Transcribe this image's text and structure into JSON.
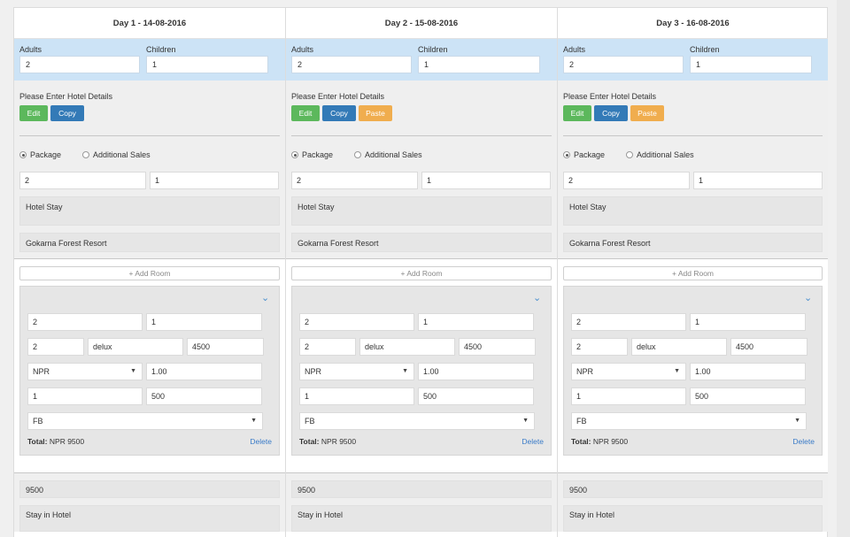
{
  "days": [
    {
      "title": "Day 1 -  14-08-2016",
      "adults_label": "Adults",
      "adults": "2",
      "children_label": "Children",
      "children": "1",
      "hotel_prompt": "Please Enter Hotel Details",
      "buttons": [
        "Edit",
        "Copy"
      ],
      "radio_package": "Package",
      "radio_additional": "Additional Sales",
      "count_a": "2",
      "count_b": "1",
      "service": "Hotel Stay",
      "hotel_name": "Gokarna Forest Resort",
      "add_room": "+ Add Room",
      "room": {
        "r1a": "2",
        "r1b": "1",
        "r2a": "2",
        "r2b": "delux",
        "r2c": "4500",
        "currency": "NPR",
        "rate": "1.00",
        "r4a": "1",
        "r4b": "500",
        "meal": "FB",
        "total_label": "Total:",
        "total_value": "NPR 9500",
        "delete": "Delete"
      },
      "amount": "9500",
      "note": "Stay in Hotel"
    },
    {
      "title": "Day 2 -  15-08-2016",
      "adults_label": "Adults",
      "adults": "2",
      "children_label": "Children",
      "children": "1",
      "hotel_prompt": "Please Enter Hotel Details",
      "buttons": [
        "Edit",
        "Copy",
        "Paste"
      ],
      "radio_package": "Package",
      "radio_additional": "Additional Sales",
      "count_a": "2",
      "count_b": "1",
      "service": "Hotel Stay",
      "hotel_name": "Gokarna Forest Resort",
      "add_room": "+ Add Room",
      "room": {
        "r1a": "2",
        "r1b": "1",
        "r2a": "2",
        "r2b": "delux",
        "r2c": "4500",
        "currency": "NPR",
        "rate": "1.00",
        "r4a": "1",
        "r4b": "500",
        "meal": "FB",
        "total_label": "Total:",
        "total_value": "NPR 9500",
        "delete": "Delete"
      },
      "amount": "9500",
      "note": "Stay in Hotel"
    },
    {
      "title": "Day 3 -  16-08-2016",
      "adults_label": "Adults",
      "adults": "2",
      "children_label": "Children",
      "children": "1",
      "hotel_prompt": "Please Enter Hotel Details",
      "buttons": [
        "Edit",
        "Copy",
        "Paste"
      ],
      "radio_package": "Package",
      "radio_additional": "Additional Sales",
      "count_a": "2",
      "count_b": "1",
      "service": "Hotel Stay",
      "hotel_name": "Gokarna Forest Resort",
      "add_room": "+ Add Room",
      "room": {
        "r1a": "2",
        "r1b": "1",
        "r2a": "2",
        "r2b": "delux",
        "r2c": "4500",
        "currency": "NPR",
        "rate": "1.00",
        "r4a": "1",
        "r4b": "500",
        "meal": "FB",
        "total_label": "Total:",
        "total_value": "NPR 9500",
        "delete": "Delete"
      },
      "amount": "9500",
      "note": "Stay in Hotel"
    }
  ],
  "colors": {
    "edit": "#5cb85c",
    "copy": "#337ab7",
    "paste": "#f0ad4e",
    "pax_bg": "#cce3f6",
    "link": "#3a7bc8"
  },
  "icons": {
    "collapse": "chevron-down-icon"
  }
}
